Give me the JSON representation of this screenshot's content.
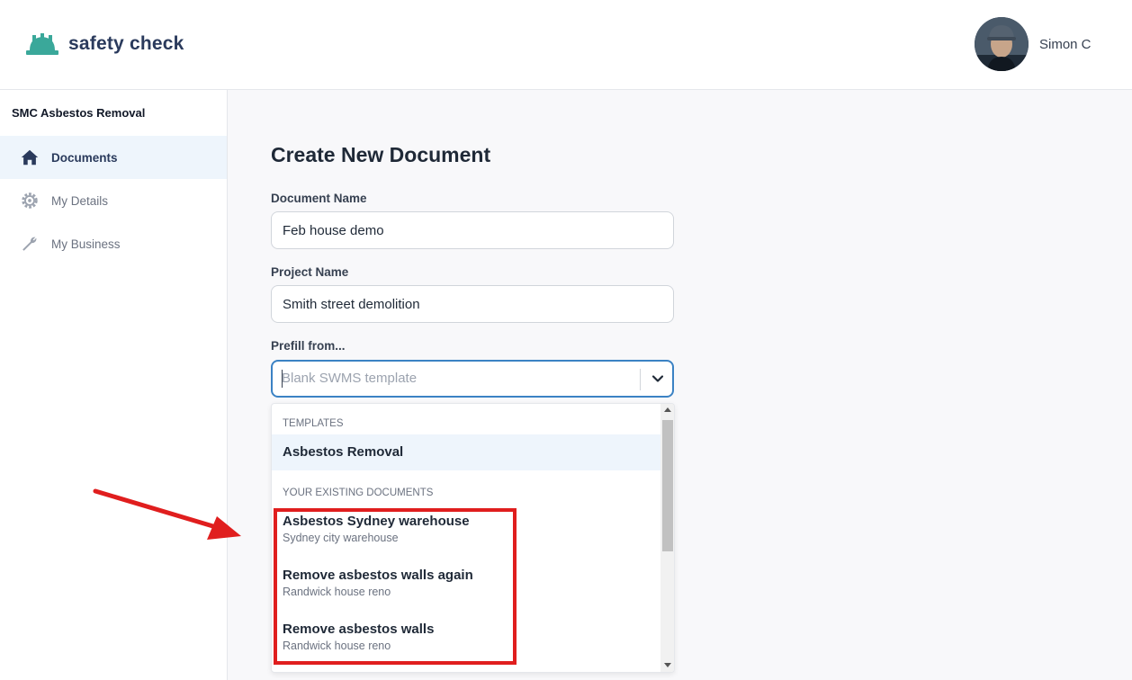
{
  "app": {
    "logo_text": "safety check",
    "brand_color": "#2a3a5c",
    "accent_color": "#3aa89a"
  },
  "user": {
    "name": "Simon C",
    "avatar_icon": "user-avatar"
  },
  "sidebar": {
    "org_name": "SMC Asbestos Removal",
    "items": [
      {
        "label": "Documents",
        "icon": "home-icon",
        "active": true
      },
      {
        "label": "My Details",
        "icon": "gear-icon",
        "active": false
      },
      {
        "label": "My Business",
        "icon": "wrench-icon",
        "active": false
      }
    ]
  },
  "form": {
    "title": "Create New Document",
    "document_name": {
      "label": "Document Name",
      "value": "Feb house demo"
    },
    "project_name": {
      "label": "Project Name",
      "value": "Smith street demolition"
    },
    "prefill": {
      "label": "Prefill from...",
      "placeholder": "Blank SWMS template",
      "groups": [
        {
          "heading": "TEMPLATES",
          "options": [
            {
              "title": "Asbestos Removal"
            }
          ]
        },
        {
          "heading": "YOUR EXISTING DOCUMENTS",
          "options": [
            {
              "title": "Asbestos Sydney warehouse",
              "subtitle": "Sydney city warehouse"
            },
            {
              "title": "Remove asbestos walls again",
              "subtitle": "Randwick house reno"
            },
            {
              "title": "Remove asbestos walls",
              "subtitle": "Randwick house reno"
            }
          ]
        }
      ]
    }
  },
  "annotation": {
    "color": "#e01e1e"
  }
}
